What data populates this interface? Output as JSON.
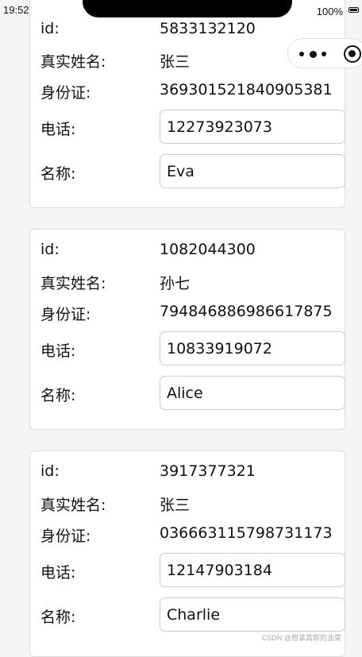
{
  "status": {
    "time": "19:52",
    "battery": "100%"
  },
  "labels": {
    "id": "id:",
    "real_name": "真实姓名:",
    "id_card": "身份证:",
    "phone": "电话:",
    "name": "名称:"
  },
  "cards": [
    {
      "id": "5833132120",
      "real_name": "张三",
      "id_card": "369301521840905381",
      "phone": "12273923073",
      "name": "Eva"
    },
    {
      "id": "1082044300",
      "real_name": "孙七",
      "id_card": "794846886986617875",
      "phone": "10833919072",
      "name": "Alice"
    },
    {
      "id": "3917377321",
      "real_name": "张三",
      "id_card": "036663115798731173",
      "phone": "12147903184",
      "name": "Charlie"
    }
  ],
  "watermark": "CSDN @想拿高薪的韭菜"
}
